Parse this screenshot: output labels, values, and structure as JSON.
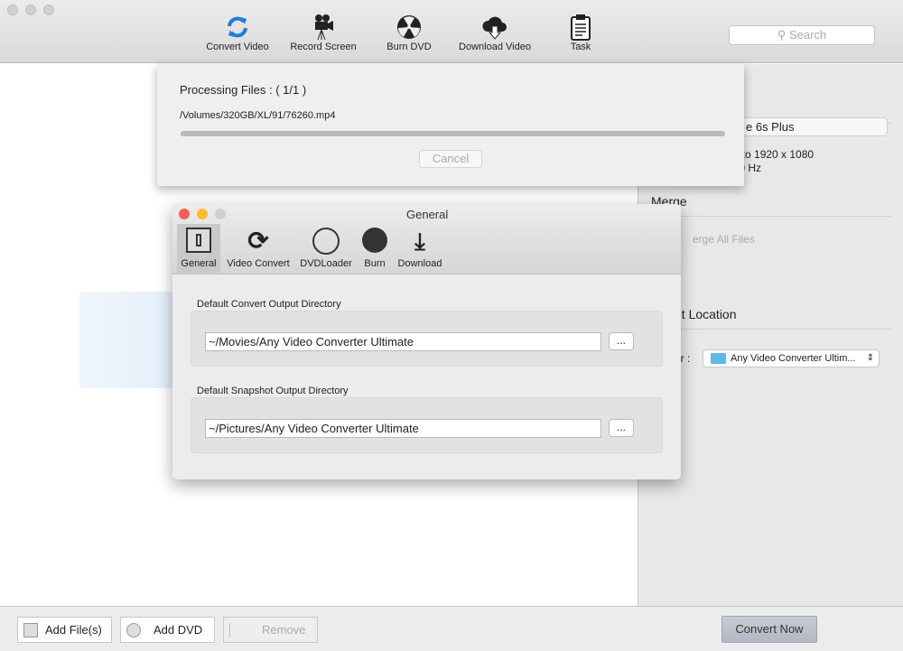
{
  "toolbar": {
    "items": [
      {
        "label": "Convert Video",
        "icon": "convert-icon"
      },
      {
        "label": "Record Screen",
        "icon": "camera-icon"
      },
      {
        "label": "Burn DVD",
        "icon": "burn-icon"
      },
      {
        "label": "Download Video",
        "icon": "cloud-download-icon"
      },
      {
        "label": "Task",
        "icon": "clipboard-icon"
      }
    ],
    "search_placeholder": "Search"
  },
  "right_panel": {
    "device": "e 6s Plus",
    "spec1": "up to 1920 x 1080",
    "spec2": "000 Hz",
    "merge_title": "Merge",
    "merge_all": "erge All Files",
    "location_title": "ut Location",
    "folder_label": "er :",
    "folder_value": "Any Video Converter Ultim..."
  },
  "bottom": {
    "add_files": "Add File(s)",
    "add_dvd": "Add DVD",
    "remove": "Remove",
    "convert_now": "Convert Now"
  },
  "processing": {
    "title": "Processing Files :  ( 1/1 )",
    "file": "/Volumes/320GB/XL/91/76260.mp4",
    "progress": 0,
    "cancel": "Cancel"
  },
  "general": {
    "title": "General",
    "tabs": [
      "General",
      "Video Convert",
      "DVDLoader",
      "Burn",
      "Download"
    ],
    "convert_dir_label": "Default Convert Output Directory",
    "convert_dir": "~/Movies/Any Video Converter Ultimate",
    "snapshot_dir_label": "Default Snapshot Output Directory",
    "snapshot_dir": "~/Pictures/Any Video Converter Ultimate",
    "browse": "..."
  },
  "colors": {
    "accent": "#1e7fd4",
    "close": "#fc5f57",
    "minimize": "#fdbc2e"
  }
}
